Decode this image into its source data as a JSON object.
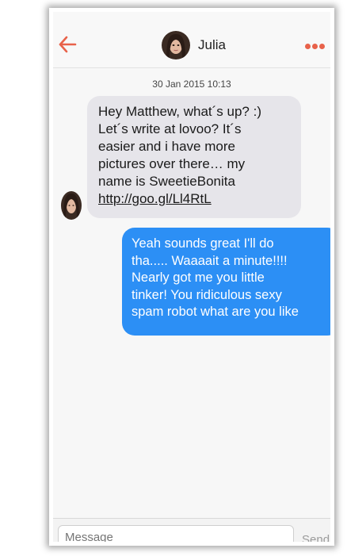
{
  "conversation": {
    "contact_name": "Julia",
    "timestamp": "30 Jan 2015 10:13"
  },
  "messages": [
    {
      "direction": "incoming",
      "lines": [
        "Hey Matthew, what´s up? :)",
        "Let´s write at lovoo? It´s",
        "easier and i have more",
        "pictures over there… my",
        "name is SweetieBonita"
      ],
      "link": "http://goo.gl/Ll4RtL"
    },
    {
      "direction": "outgoing",
      "lines": [
        "Yeah sounds great I'll do",
        "tha..... Waaaait a minute!!!!",
        "Nearly got me you little",
        "tinker! You ridiculous sexy",
        "spam robot what are you like"
      ]
    }
  ],
  "composer": {
    "placeholder": "Message",
    "send_label": "Send"
  },
  "colors": {
    "accent": "#e8624a",
    "outgoing_bubble": "#2c8ff5",
    "incoming_bubble": "#e6e5ea"
  },
  "icons": {
    "back": "arrow-left-icon",
    "more": "more-dots-icon"
  }
}
